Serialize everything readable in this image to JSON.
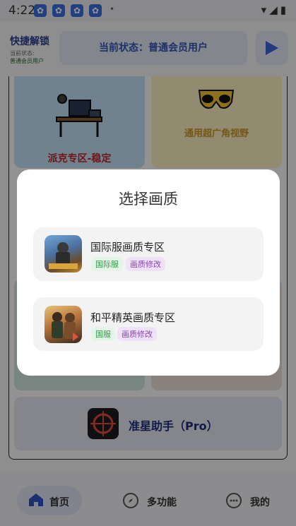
{
  "status_bar": {
    "time": "4:22",
    "app_icons": [
      "paw-icon",
      "paw-icon",
      "paw-icon",
      "paw-icon"
    ],
    "dot": "•",
    "right_icons": [
      "wifi-icon",
      "signal-icon",
      "battery-icon"
    ]
  },
  "header": {
    "title": "快捷解锁",
    "small_label": "当前状态:",
    "small_value": "普通会员用户",
    "status_text": "当前状态：普通会员用户",
    "play_icon": "play-icon"
  },
  "background_cards": {
    "card_a_label": "派克专区-稳定",
    "card_b_label": "通用超广角视野",
    "aim_label": "准星助手（Pro）"
  },
  "bottom_nav": {
    "items": [
      {
        "label": "首页",
        "icon": "home-icon"
      },
      {
        "label": "多功能",
        "icon": "compass-icon"
      },
      {
        "label": "我的",
        "icon": "chat-icon"
      }
    ]
  },
  "dialog": {
    "title": "选择画质",
    "options": [
      {
        "title": "国际服画质专区",
        "tags": [
          "国际服",
          "画质修改"
        ],
        "icon": "pubg-icon"
      },
      {
        "title": "和平精英画质专区",
        "tags": [
          "国服",
          "画质修改"
        ],
        "icon": "peace-elite-icon"
      }
    ]
  },
  "colors": {
    "accent": "#3a63d8",
    "tag_green": "#2f9a47",
    "tag_purple": "#8b3fc0"
  }
}
